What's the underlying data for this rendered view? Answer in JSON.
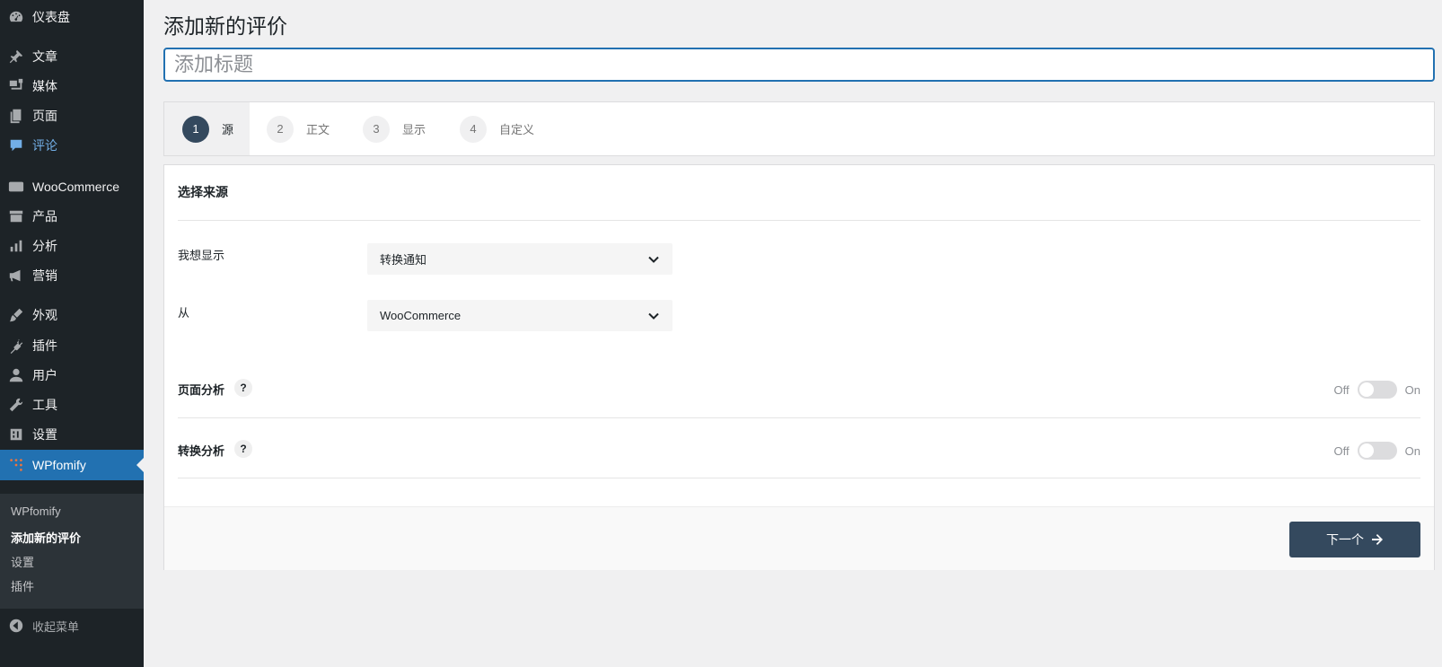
{
  "sidebar": {
    "items": [
      {
        "label": "仪表盘",
        "icon": "dashboard-icon"
      },
      {
        "label": "文章",
        "icon": "pin-icon"
      },
      {
        "label": "媒体",
        "icon": "media-icon"
      },
      {
        "label": "页面",
        "icon": "pages-icon"
      },
      {
        "label": "评论",
        "icon": "comments-icon"
      },
      {
        "label": "WooCommerce",
        "icon": "woo-icon"
      },
      {
        "label": "产品",
        "icon": "archive-icon"
      },
      {
        "label": "分析",
        "icon": "bar-chart-icon"
      },
      {
        "label": "营销",
        "icon": "megaphone-icon"
      },
      {
        "label": "外观",
        "icon": "brush-icon"
      },
      {
        "label": "插件",
        "icon": "plugin-icon"
      },
      {
        "label": "用户",
        "icon": "user-icon"
      },
      {
        "label": "工具",
        "icon": "wrench-icon"
      },
      {
        "label": "设置",
        "icon": "settings-icon"
      },
      {
        "label": "WPfomify",
        "icon": "wpfomify-icon"
      }
    ],
    "submenu": [
      "WPfomify",
      "添加新的评价",
      "设置",
      "插件"
    ],
    "collapse_label": "收起菜单"
  },
  "page": {
    "title": "添加新的评价",
    "title_placeholder": "添加标题"
  },
  "steps": [
    {
      "num": "1",
      "label": "源"
    },
    {
      "num": "2",
      "label": "正文"
    },
    {
      "num": "3",
      "label": "显示"
    },
    {
      "num": "4",
      "label": "自定义"
    }
  ],
  "form": {
    "section_title": "选择来源",
    "show_label": "我想显示",
    "show_value": "转换通知",
    "from_label": "从",
    "from_value": "WooCommerce",
    "page_analytics_label": "页面分析",
    "conversion_analytics_label": "转换分析",
    "help": "?",
    "off": "Off",
    "on": "On",
    "page_analytics_enabled": false,
    "conversion_analytics_enabled": false
  },
  "footer": {
    "next_label": "下一个"
  },
  "colors": {
    "sidebar_bg": "#1d2327",
    "active_menu": "#2271b1",
    "step_active": "#34495e",
    "next_button": "#34495e",
    "highlight_text": "#72aee6"
  }
}
